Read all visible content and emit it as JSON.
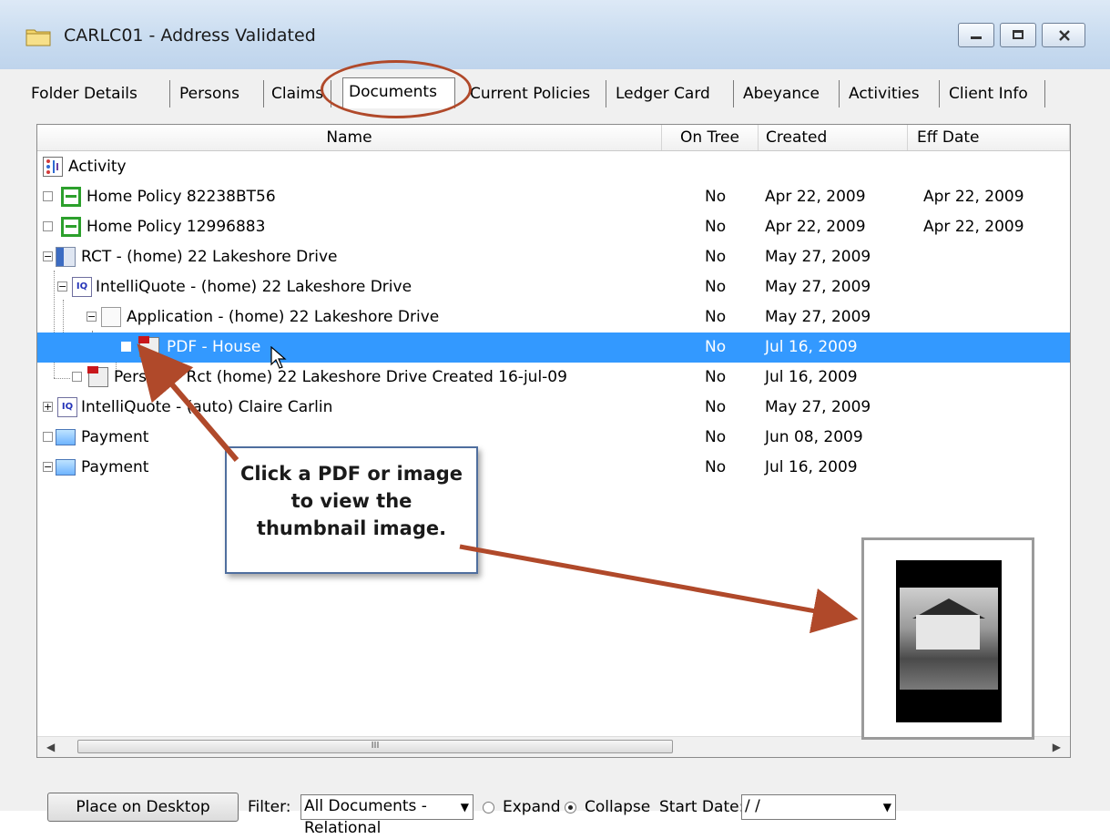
{
  "window": {
    "title": "CARLC01 - Address Validated"
  },
  "tabs": [
    {
      "label": "Folder Details"
    },
    {
      "label": "Persons"
    },
    {
      "label": "Claims"
    },
    {
      "label": "Documents"
    },
    {
      "label": "Current Policies"
    },
    {
      "label": "Ledger Card"
    },
    {
      "label": "Abeyance"
    },
    {
      "label": "Activities"
    },
    {
      "label": "Client Info"
    }
  ],
  "columns": {
    "name": "Name",
    "on_tree": "On Tree",
    "created": "Created",
    "eff_date": "Eff Date"
  },
  "rows": [
    {
      "name": "Activity",
      "on_tree": "",
      "created": "",
      "eff": "",
      "icon": "activity-icon"
    },
    {
      "name": "Home Policy 82238BT56",
      "on_tree": "No",
      "created": "Apr 22, 2009",
      "eff": "Apr 22, 2009",
      "icon": "policy-icon"
    },
    {
      "name": "Home Policy 12996883",
      "on_tree": "No",
      "created": "Apr 22, 2009",
      "eff": "Apr 22, 2009",
      "icon": "policy-icon"
    },
    {
      "name": "RCT - (home) 22 Lakeshore Drive",
      "on_tree": "No",
      "created": "May 27, 2009",
      "eff": "",
      "icon": "rct-icon"
    },
    {
      "name": "IntelliQuote - (home) 22 Lakeshore Drive",
      "on_tree": "No",
      "created": "May 27, 2009",
      "eff": "",
      "icon": "intelliquote-icon"
    },
    {
      "name": "Application - (home) 22 Lakeshore Drive",
      "on_tree": "No",
      "created": "May 27, 2009",
      "eff": "",
      "icon": "application-icon"
    },
    {
      "name": "PDF - House",
      "on_tree": "No",
      "created": "Jul 16, 2009",
      "eff": "",
      "icon": "pdf-icon"
    },
    {
      "name": "Pers    ed - Rct (home) 22 Lakeshore Drive Created 16-jul-09",
      "on_tree": "No",
      "created": "Jul 16, 2009",
      "eff": "",
      "icon": "pdf-icon"
    },
    {
      "name": "IntelliQuote - (auto) Claire Carlin",
      "on_tree": "No",
      "created": "May 27, 2009",
      "eff": "",
      "icon": "intelliquote-icon"
    },
    {
      "name": "Payment",
      "on_tree": "No",
      "created": "Jun 08, 2009",
      "eff": "",
      "icon": "payment-icon"
    },
    {
      "name": "Payment",
      "on_tree": "No",
      "created": "Jul 16, 2009",
      "eff": "",
      "icon": "payment-icon"
    }
  ],
  "scrollbar": {
    "thumb_grip": "III"
  },
  "callout": {
    "line1": "Click a PDF or image",
    "line2": "to view the",
    "line3": "thumbnail image."
  },
  "bottom": {
    "place_button": "Place on Desktop",
    "filter_label": "Filter:",
    "filter_value": "All Documents - Relational",
    "expand_label": "Expand",
    "collapse_label": "Collapse",
    "start_date_label": "Start Date:",
    "start_date_value": " / /"
  },
  "colors": {
    "selection": "#3399ff",
    "annotation": "#b0492a",
    "callout_border": "#4f6e9e"
  }
}
